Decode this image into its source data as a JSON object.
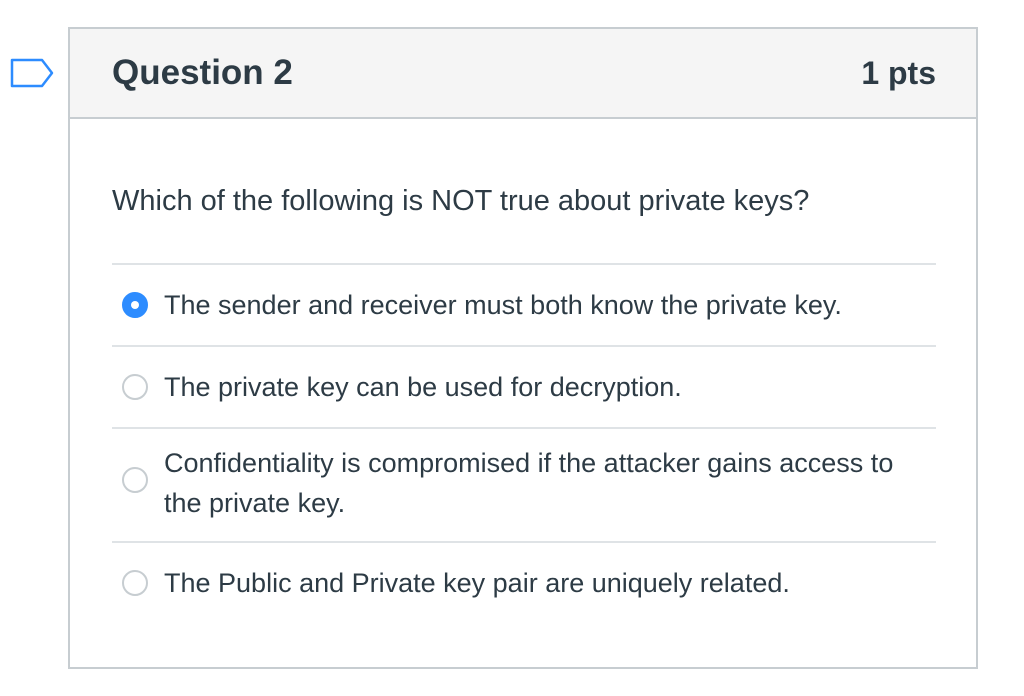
{
  "question": {
    "title": "Question 2",
    "points": "1 pts",
    "text": "Which of the following is NOT true about private keys?"
  },
  "answers": [
    {
      "label": "The sender and receiver must both know the private key.",
      "selected": true
    },
    {
      "label": "The private key can be used for decryption.",
      "selected": false
    },
    {
      "label": "Confidentiality is compromised if the attacker gains access to the private key.",
      "selected": false
    },
    {
      "label": "The Public and Private key pair are uniquely related.",
      "selected": false
    }
  ],
  "colors": {
    "accent": "#2d8cff",
    "text": "#2d3b45",
    "border": "#c7cdd1",
    "header_bg": "#f5f5f5"
  },
  "icons": {
    "flag": "flag-question-icon"
  }
}
